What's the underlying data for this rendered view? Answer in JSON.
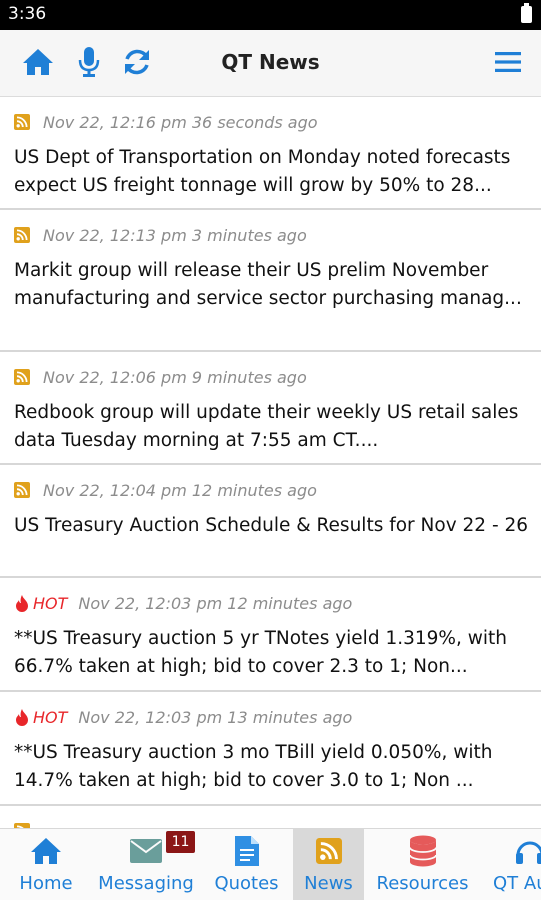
{
  "status_bar": {
    "time": "3:36"
  },
  "header": {
    "title": "QT News"
  },
  "news": [
    {
      "meta": "Nov 22, 12:16 pm 36 seconds ago",
      "hot": false,
      "headline": "US Dept of Transportation on Monday noted forecasts expect US freight tonnage will grow by 50% to 28..."
    },
    {
      "meta": "Nov 22, 12:13 pm 3 minutes ago",
      "hot": false,
      "headline": "Markit group will release their US prelim November manufacturing and service sector purchasing manag..."
    },
    {
      "meta": "Nov 22, 12:06 pm 9 minutes ago",
      "hot": false,
      "headline": "Redbook group will update their weekly US retail sales data Tuesday morning at 7:55 am CT...."
    },
    {
      "meta": "Nov 22, 12:04 pm 12 minutes ago",
      "hot": false,
      "headline": "US Treasury Auction Schedule & Results for Nov 22 - 26"
    },
    {
      "meta": "Nov 22, 12:03 pm 12 minutes ago",
      "hot": true,
      "hot_label": "HOT",
      "headline": "**US Treasury auction 5 yr TNotes yield 1.319%, with 66.7% taken at high; bid to cover 2.3 to 1; Non..."
    },
    {
      "meta": "Nov 22, 12:03 pm 13 minutes ago",
      "hot": true,
      "hot_label": "HOT",
      "headline": "**US Treasury auction 3 mo TBill yield 0.050%, with 14.7% taken at high; bid to cover 3.0 to 1; Non ..."
    }
  ],
  "tabs": [
    {
      "label": "Home",
      "icon": "home-icon"
    },
    {
      "label": "Messaging",
      "icon": "envelope-icon",
      "badge": "11"
    },
    {
      "label": "Quotes",
      "icon": "document-icon"
    },
    {
      "label": "News",
      "icon": "rss-icon",
      "active": true
    },
    {
      "label": "Resources",
      "icon": "database-icon"
    },
    {
      "label": "QT Au",
      "icon": "headphones-icon"
    }
  ],
  "colors": {
    "accent": "#1f7fd6",
    "rss": "#e0a11c",
    "hot": "#e8262a",
    "badge": "#8b1616"
  }
}
